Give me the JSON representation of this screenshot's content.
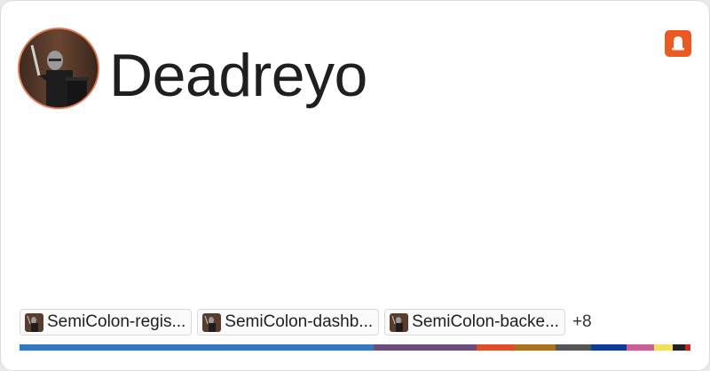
{
  "profile": {
    "username": "Deadreyo",
    "avatar_icon": "knight-avatar"
  },
  "brand": {
    "icon": "bell-app-logo",
    "color": "#ea5a22"
  },
  "repos": [
    {
      "label": "SemiColon-regis..."
    },
    {
      "label": "SemiColon-dashb..."
    },
    {
      "label": "SemiColon-backe..."
    }
  ],
  "more_label": "+8",
  "language_bar": [
    {
      "color": "#3178c6",
      "share": 0.529
    },
    {
      "color": "#6e4a7e",
      "share": 0.153
    },
    {
      "color": "#e34c26",
      "share": 0.058
    },
    {
      "color": "#b07219",
      "share": 0.061
    },
    {
      "color": "#555555",
      "share": 0.053
    },
    {
      "color": "#0c3c9c",
      "share": 0.053
    },
    {
      "color": "#cc5e9a",
      "share": 0.04
    },
    {
      "color": "#f1e05a",
      "share": 0.029
    },
    {
      "color": "#222222",
      "share": 0.018
    },
    {
      "color": "#cc1f1f",
      "share": 0.008
    }
  ]
}
